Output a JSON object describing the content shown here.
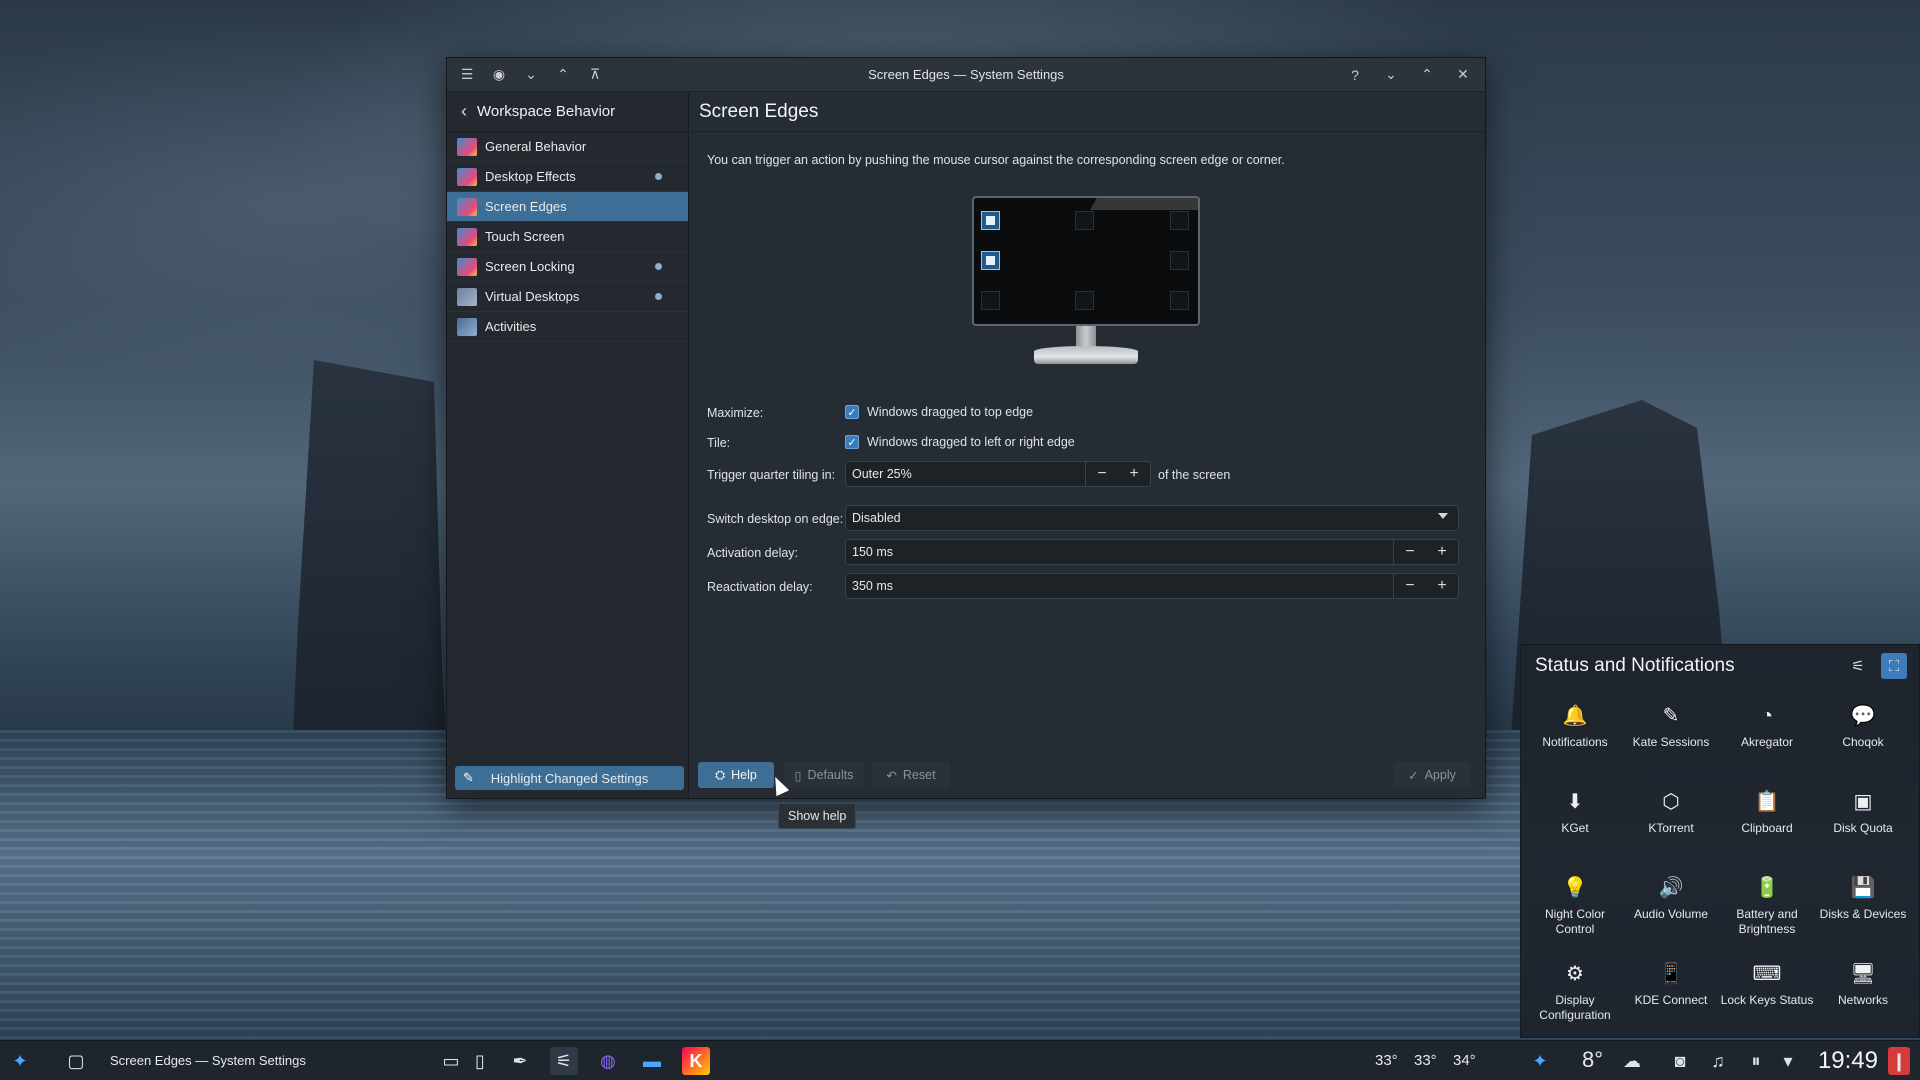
{
  "window": {
    "title": "Screen Edges — System Settings",
    "titlebar_left_icons": [
      "settings-menu-icon",
      "pin-icon",
      "keep-below-icon",
      "keep-above-icon",
      "shade-icon"
    ],
    "titlebar_right_icons": [
      "help-icon",
      "minimize-icon",
      "maximize-icon",
      "close-icon"
    ]
  },
  "sidebar": {
    "header": "Workspace Behavior",
    "items": [
      {
        "label": "General Behavior",
        "active": false,
        "changed": false
      },
      {
        "label": "Desktop Effects",
        "active": false,
        "changed": true
      },
      {
        "label": "Screen Edges",
        "active": true,
        "changed": false
      },
      {
        "label": "Touch Screen",
        "active": false,
        "changed": false
      },
      {
        "label": "Screen Locking",
        "active": false,
        "changed": true
      },
      {
        "label": "Virtual Desktops",
        "active": false,
        "changed": true
      },
      {
        "label": "Activities",
        "active": false,
        "changed": false
      }
    ],
    "footer_button": "Highlight Changed Settings"
  },
  "content": {
    "title": "Screen Edges",
    "description": "You can trigger an action by pushing the mouse cursor against the corresponding screen edge or corner.",
    "maximize_label": "Maximize:",
    "maximize_check": "Windows dragged to top edge",
    "tile_label": "Tile:",
    "tile_check": "Windows dragged to left or right edge",
    "quarter_label": "Trigger quarter tiling in:",
    "quarter_value": "Outer 25%",
    "quarter_suffix": "of the screen",
    "switch_label": "Switch desktop on edge:",
    "switch_value": "Disabled",
    "activation_label": "Activation delay:",
    "activation_value": "150 ms",
    "reactivation_label": "Reactivation delay:",
    "reactivation_value": "350 ms",
    "minus": "−",
    "plus": "+"
  },
  "buttons": {
    "help": "Help",
    "defaults": "Defaults",
    "reset": "Reset",
    "apply": "Apply"
  },
  "tooltip": "Show help",
  "tray_popup": {
    "title": "Status and Notifications",
    "items": [
      {
        "label": "Notifications",
        "icon": "bell-icon",
        "glyph": "🔔"
      },
      {
        "label": "Kate Sessions",
        "icon": "kate-icon",
        "glyph": "✎"
      },
      {
        "label": "Akregator",
        "icon": "rss-icon",
        "glyph": "◔"
      },
      {
        "label": "Choqok",
        "icon": "chat-icon",
        "glyph": "💬"
      },
      {
        "label": "KGet",
        "icon": "download-icon",
        "glyph": "⬇"
      },
      {
        "label": "KTorrent",
        "icon": "torrent-icon",
        "glyph": "⬡"
      },
      {
        "label": "Clipboard",
        "icon": "clipboard-icon",
        "glyph": "📋"
      },
      {
        "label": "Disk Quota",
        "icon": "disk-quota-icon",
        "glyph": "▣"
      },
      {
        "label": "Night Color Control",
        "icon": "night-color-icon",
        "glyph": "💡"
      },
      {
        "label": "Audio Volume",
        "icon": "speaker-icon",
        "glyph": "🔊"
      },
      {
        "label": "Battery and Brightness",
        "icon": "battery-icon",
        "glyph": "🔋"
      },
      {
        "label": "Disks & Devices",
        "icon": "usb-drive-icon",
        "glyph": "💾"
      },
      {
        "label": "Display Configuration",
        "icon": "display-config-icon",
        "glyph": "⚙"
      },
      {
        "label": "KDE Connect",
        "icon": "phone-icon",
        "glyph": "📱"
      },
      {
        "label": "Lock Keys Status",
        "icon": "keyboard-icon",
        "glyph": "⌨"
      },
      {
        "label": "Networks",
        "icon": "network-icon",
        "glyph": "🖥"
      }
    ]
  },
  "taskbar": {
    "task_label": "Screen Edges — System Settings",
    "temps": [
      "33°",
      "33°",
      "34°"
    ],
    "weather": "8°",
    "clock": "19:49"
  },
  "colors": {
    "accent": "#3d6e96",
    "checkbox": "#3d7cb8"
  }
}
